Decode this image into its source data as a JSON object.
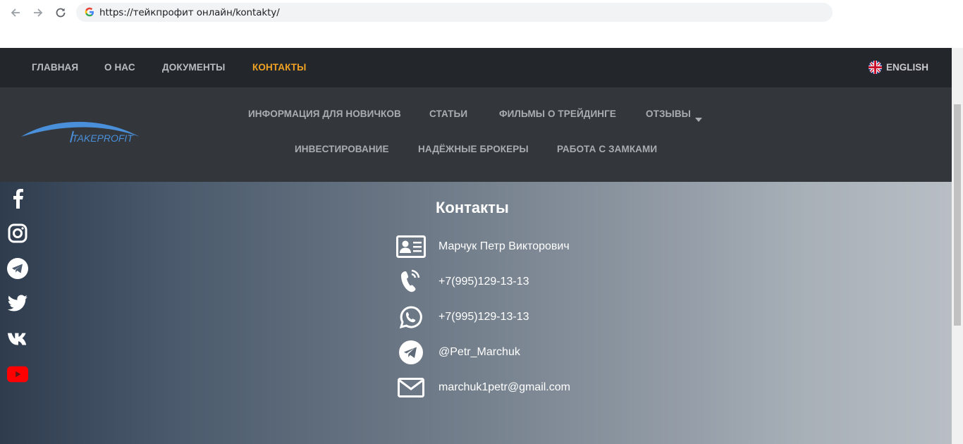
{
  "browser": {
    "url": "https://тейкпрофит онлайн/kontakty/",
    "back_icon": "arrow-left-icon",
    "forward_icon": "arrow-right-icon",
    "reload_icon": "reload-icon",
    "site_icon": "google-g-icon"
  },
  "top_nav": {
    "items": [
      {
        "label": "ГЛАВНАЯ"
      },
      {
        "label": "О НАС"
      },
      {
        "label": "ДОКУМЕНТЫ"
      },
      {
        "label": "КОНТАКТЫ",
        "active": true
      }
    ],
    "language": {
      "label": "ENGLISH",
      "icon": "uk-flag-icon"
    },
    "active_color": "#f0a224"
  },
  "logo": {
    "text": "TAKEPROFIT",
    "color": "#4a8fd9"
  },
  "main_nav": {
    "row1": [
      {
        "label": "ИНФОРМАЦИЯ ДЛЯ НОВИЧКОВ"
      },
      {
        "label": "СТАТЬИ"
      },
      {
        "label": "ФИЛЬМЫ О ТРЕЙДИНГЕ"
      },
      {
        "label": "ОТЗЫВЫ",
        "dropdown": true
      }
    ],
    "row2": [
      {
        "label": "ИНВЕСТИРОВАНИЕ"
      },
      {
        "label": "НАДЁЖНЫЕ БРОКЕРЫ"
      },
      {
        "label": "РАБОТА С ЗАМКАМИ"
      }
    ]
  },
  "social": [
    "facebook-icon",
    "instagram-icon",
    "telegram-icon",
    "twitter-icon",
    "vk-icon",
    "youtube-icon"
  ],
  "contacts": {
    "title": "Контакты",
    "rows": [
      {
        "icon": "id-card-icon",
        "text": "Марчук Петр Викторович"
      },
      {
        "icon": "phone-icon",
        "text": "+7(995)129-13-13"
      },
      {
        "icon": "whatsapp-icon",
        "text": "+7(995)129-13-13"
      },
      {
        "icon": "telegram-icon",
        "text": "@Petr_Marchuk"
      },
      {
        "icon": "envelope-icon",
        "text": "marchuk1petr@gmail.com"
      }
    ]
  }
}
